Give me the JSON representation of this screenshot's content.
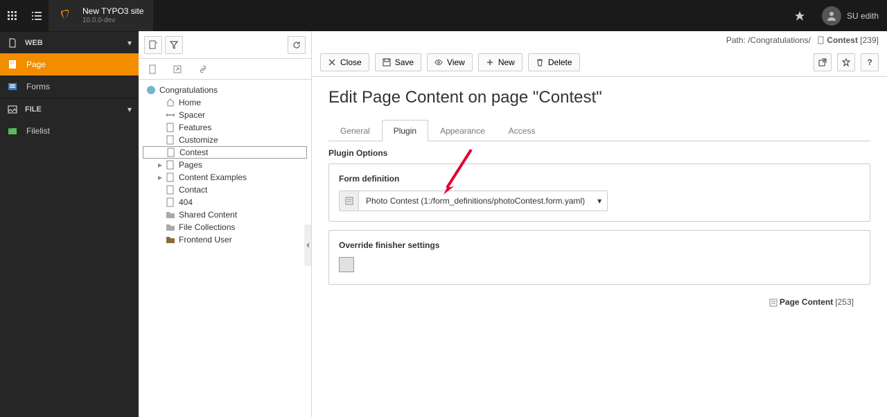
{
  "topbar": {
    "site_name": "New TYPO3 site",
    "site_version": "10.0.0-dev",
    "user_label": "SU edith"
  },
  "modules": {
    "groups": [
      {
        "label": "WEB",
        "items": [
          {
            "label": "Page",
            "active": true
          },
          {
            "label": "Forms",
            "active": false
          }
        ]
      },
      {
        "label": "FILE",
        "items": [
          {
            "label": "Filelist",
            "active": false
          }
        ]
      }
    ]
  },
  "tree": {
    "root": "Congratulations",
    "nodes": [
      {
        "label": "Home",
        "icon": "home"
      },
      {
        "label": "Spacer",
        "icon": "spacer"
      },
      {
        "label": "Features",
        "icon": "page"
      },
      {
        "label": "Customize",
        "icon": "page"
      },
      {
        "label": "Contest",
        "icon": "page",
        "active": true
      },
      {
        "label": "Pages",
        "icon": "page",
        "expandable": true
      },
      {
        "label": "Content Examples",
        "icon": "page",
        "expandable": true
      },
      {
        "label": "Contact",
        "icon": "page"
      },
      {
        "label": "404",
        "icon": "page"
      },
      {
        "label": "Shared Content",
        "icon": "folder"
      },
      {
        "label": "File Collections",
        "icon": "folder"
      },
      {
        "label": "Frontend User",
        "icon": "users"
      }
    ]
  },
  "docheader": {
    "path_prefix": "Path: ",
    "path_link": "/Congratulations/",
    "breadcrumb_title": "Contest",
    "breadcrumb_uid": "[239]",
    "buttons": {
      "close": "Close",
      "save": "Save",
      "view": "View",
      "new": "New",
      "delete": "Delete"
    }
  },
  "page": {
    "heading": "Edit Page Content on page \"Contest\"",
    "tabs": [
      "General",
      "Plugin",
      "Appearance",
      "Access"
    ],
    "active_tab": "Plugin",
    "plugin_options_label": "Plugin Options",
    "form_definition_label": "Form definition",
    "form_definition_value": "Photo Contest (1:/form_definitions/photoContest.form.yaml)",
    "override_label": "Override finisher settings"
  },
  "footer": {
    "type_label": "Page Content",
    "uid": "[253]"
  }
}
